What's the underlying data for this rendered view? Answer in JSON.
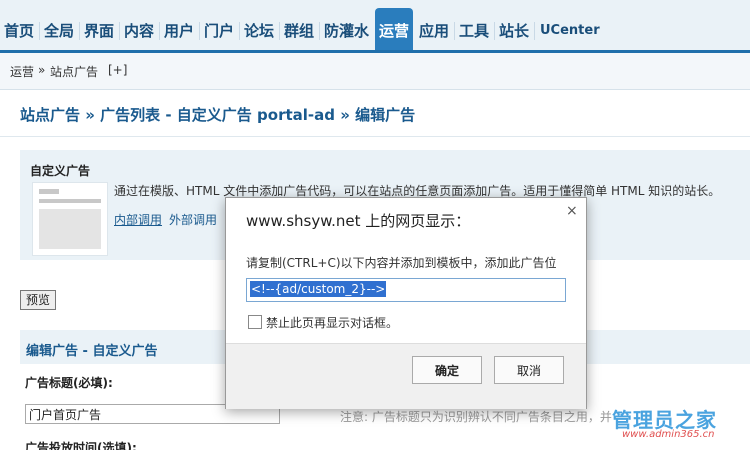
{
  "nav": {
    "items": [
      "首页",
      "全局",
      "界面",
      "内容",
      "用户",
      "门户",
      "论坛",
      "群组",
      "防灌水",
      "运营",
      "应用",
      "工具",
      "站长",
      "UCenter"
    ],
    "active": "运营"
  },
  "breadcrumb": {
    "section": "运营",
    "sep": "»",
    "page": "站点广告",
    "add": "[+]"
  },
  "heading": "站点广告 » 广告列表 - 自定义广告 portal-ad » 编辑广告",
  "panel": {
    "title": "自定义广告",
    "description": "通过在模版、HTML 文件中添加广告代码，可以在站点的任意页面添加广告。适用于懂得简单 HTML 知识的站长。",
    "internal_link": "内部调用",
    "external_link": "外部调用"
  },
  "preview_button": "预览",
  "edit_section": {
    "title": "编辑广告 - 自定义广告",
    "field_label": "广告标题(必填):",
    "field_value": "门户首页广告",
    "note": "注意: 广告标题只为识别辨认不同广告条目之用，并",
    "next_label": "广告投放时间(选填):"
  },
  "dialog": {
    "title": "www.shsyw.net 上的网页显示：",
    "message": "请复制(CTRL+C)以下内容并添加到模板中，添加此广告位",
    "code": "<!--{ad/custom_2}-->",
    "checkbox_label": "禁止此页再显示对话框。",
    "ok": "确定",
    "cancel": "取消",
    "close": "×"
  },
  "watermark": {
    "text": "管理员之家",
    "url": "www.admin365.cn"
  },
  "colors": {
    "accent": "#2a7dbd",
    "link": "#1a5a8e",
    "panel": "#eaf2f7"
  }
}
